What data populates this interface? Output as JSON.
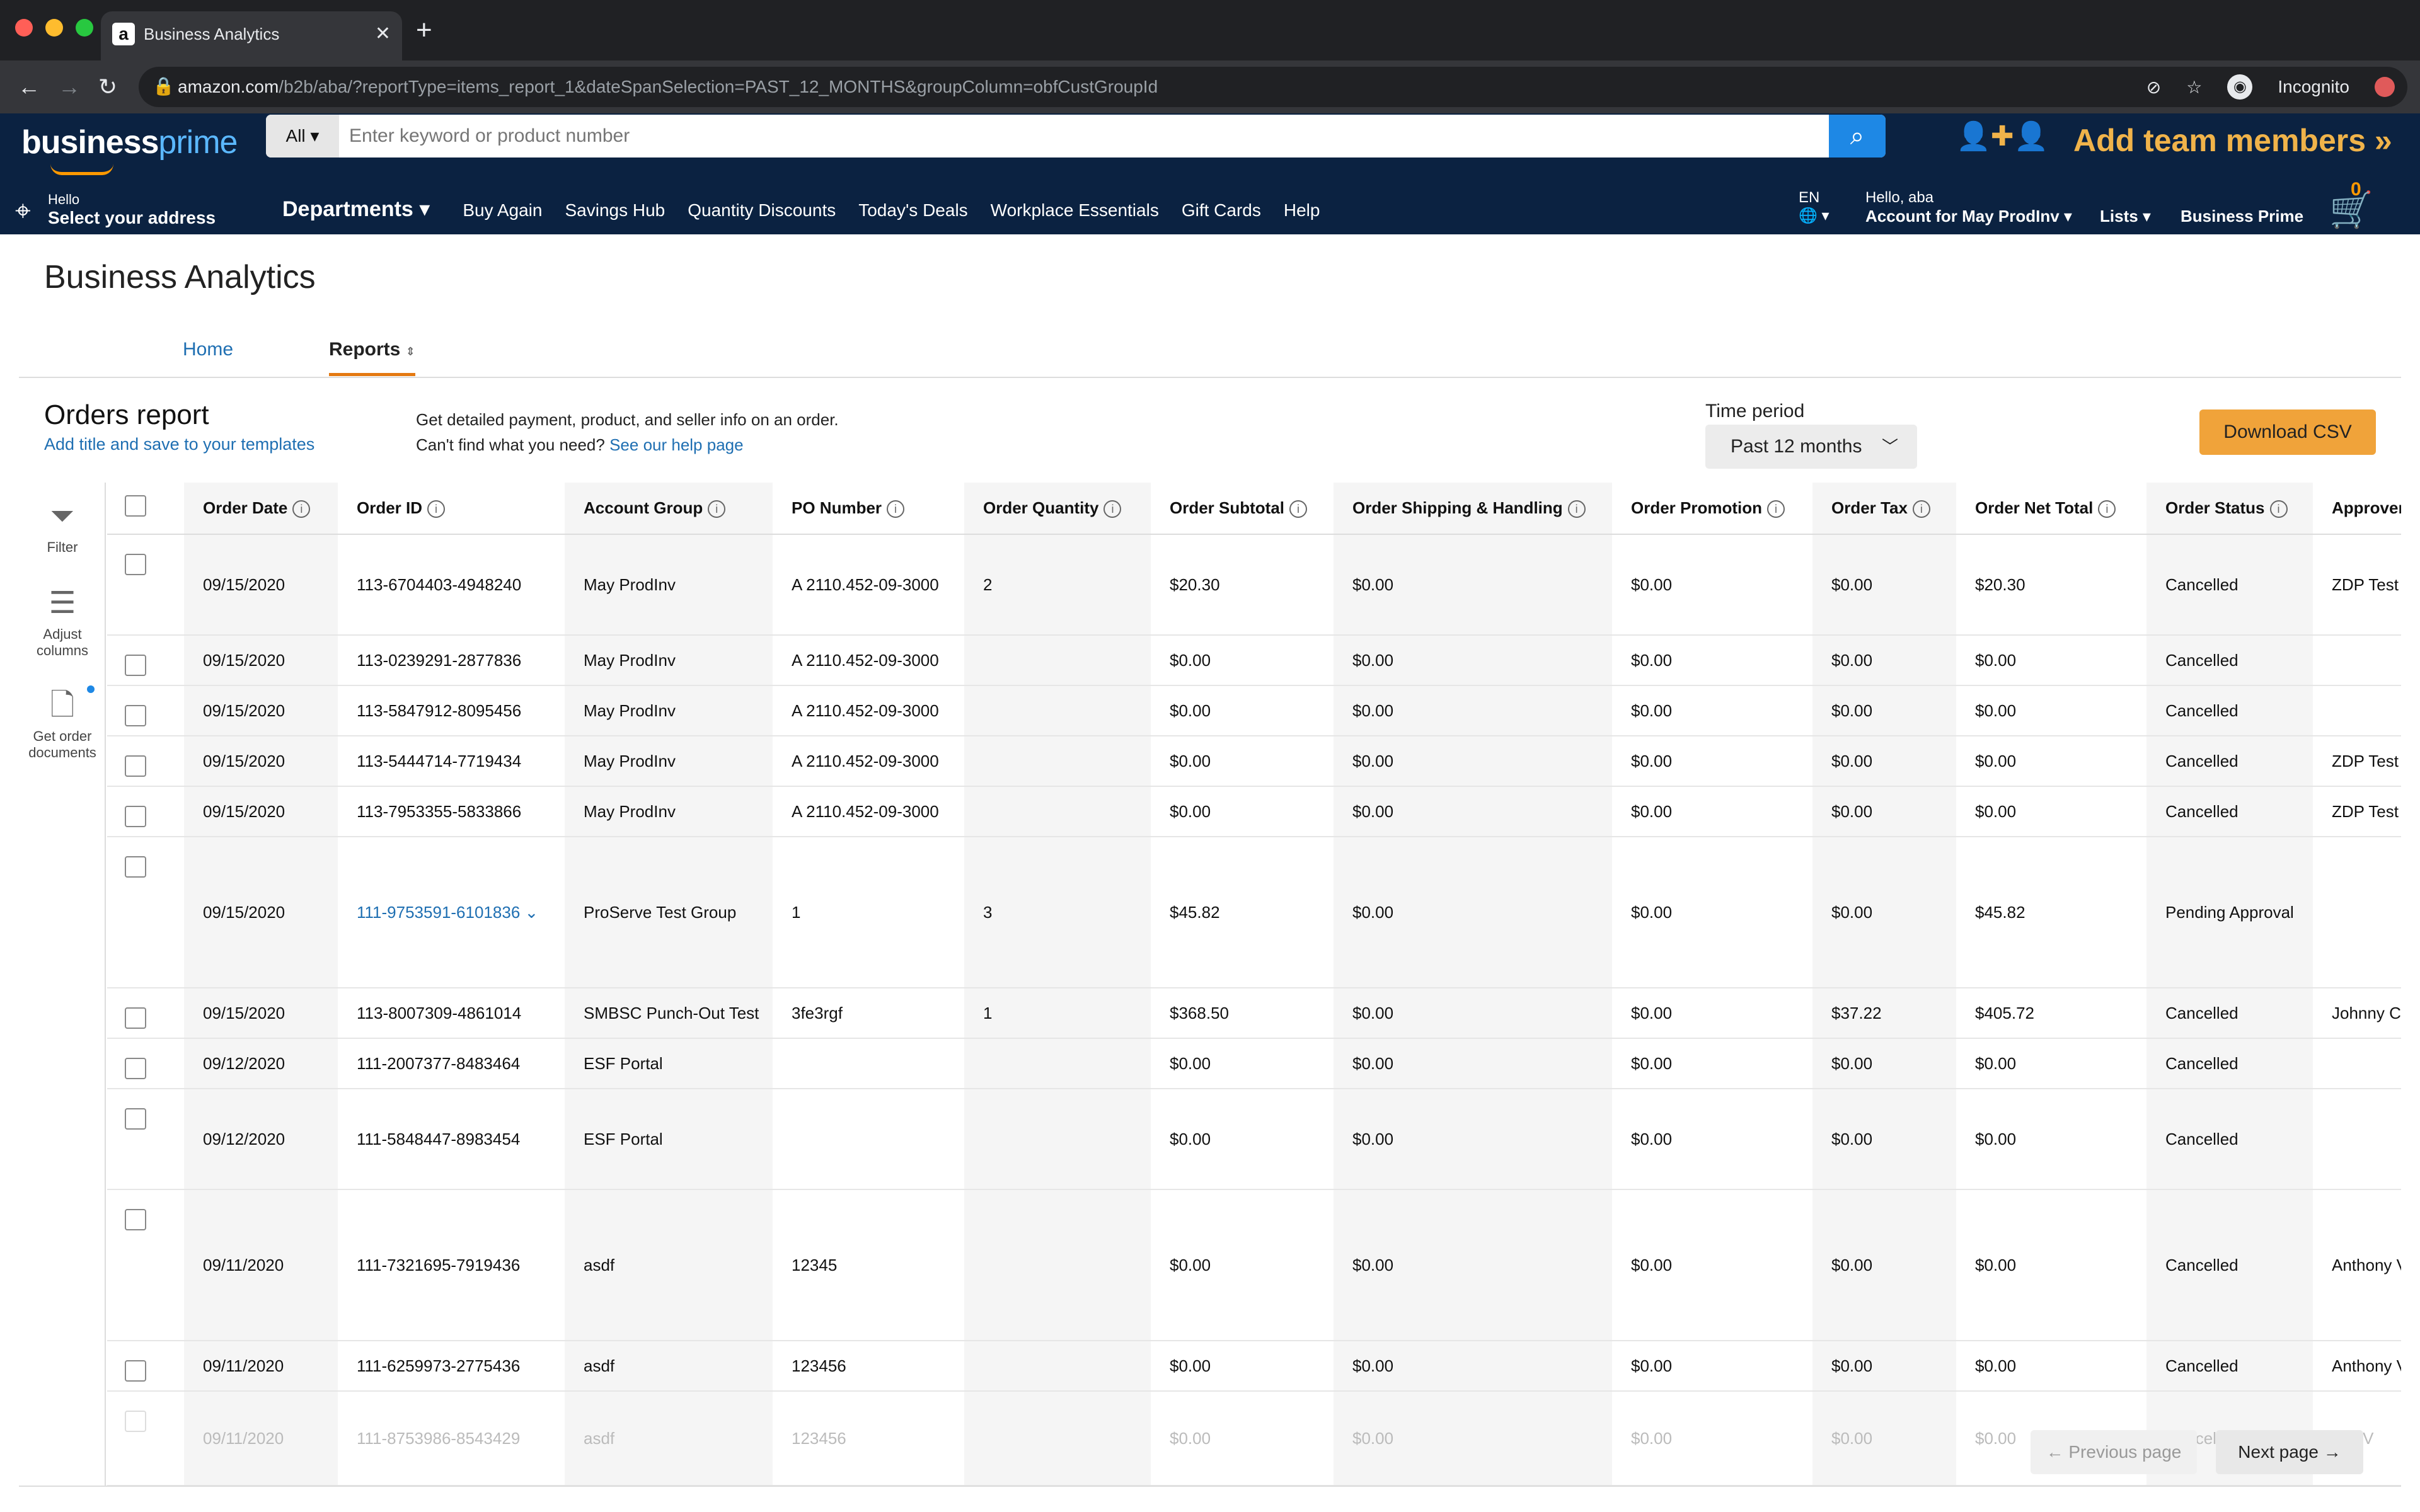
{
  "browser": {
    "tab_title": "Business Analytics",
    "url_host": "amazon.com",
    "url_path": "/b2b/aba/?reportType=items_report_1&dateSpanSelection=PAST_12_MONTHS&groupColumn=obfCustGroupId",
    "profile_label": "Incognito"
  },
  "header": {
    "logo_main": "business",
    "logo_accent": "prime",
    "search_category": "All",
    "search_placeholder": "Enter keyword or product number",
    "add_team_label": "Add team members »",
    "deliver_hello": "Hello",
    "deliver_address": "Select your address",
    "departments_label": "Departments",
    "nav_links": [
      "Buy Again",
      "Savings Hub",
      "Quantity Discounts",
      "Today's Deals",
      "Workplace Essentials",
      "Gift Cards",
      "Help"
    ],
    "language": "EN",
    "greeting": "Hello, aba",
    "account_label": "Account for May ProdInv",
    "lists_label": "Lists",
    "business_prime_label": "Business Prime",
    "cart_count": "0"
  },
  "page": {
    "title": "Business Analytics",
    "tabs": {
      "home": "Home",
      "reports": "Reports"
    }
  },
  "report": {
    "title": "Orders report",
    "subtitle_link": "Add title and save to your templates",
    "desc_line1": "Get detailed payment, product, and seller info on an order.",
    "desc_line2": "Can't find what you need?",
    "help_link": "See our help page",
    "time_period_label": "Time period",
    "time_period_value": "Past 12 months",
    "download_label": "Download CSV"
  },
  "rail": {
    "filter": "Filter",
    "adjust_line1": "Adjust",
    "adjust_line2": "columns",
    "docs_line1": "Get order",
    "docs_line2": "documents"
  },
  "table": {
    "columns": [
      "Order Date",
      "Order ID",
      "Account Group",
      "PO Number",
      "Order Quantity",
      "Order Subtotal",
      "Order Shipping & Handling",
      "Order Promotion",
      "Order Tax",
      "Order Net Total",
      "Order Status",
      "Approver"
    ],
    "rows": [
      [
        "09/15/2020",
        "113-6704403-4948240",
        "May ProdInv",
        "A 2110.452-09-3000",
        "2",
        "$20.30",
        "$0.00",
        "$0.00",
        "$0.00",
        "$20.30",
        "Cancelled",
        "ZDP Test ."
      ],
      [
        "09/15/2020",
        "113-0239291-2877836",
        "May ProdInv",
        "A 2110.452-09-3000",
        "",
        "$0.00",
        "$0.00",
        "$0.00",
        "$0.00",
        "$0.00",
        "Cancelled",
        ""
      ],
      [
        "09/15/2020",
        "113-5847912-8095456",
        "May ProdInv",
        "A 2110.452-09-3000",
        "",
        "$0.00",
        "$0.00",
        "$0.00",
        "$0.00",
        "$0.00",
        "Cancelled",
        ""
      ],
      [
        "09/15/2020",
        "113-5444714-7719434",
        "May ProdInv",
        "A 2110.452-09-3000",
        "",
        "$0.00",
        "$0.00",
        "$0.00",
        "$0.00",
        "$0.00",
        "Cancelled",
        "ZDP Test ."
      ],
      [
        "09/15/2020",
        "113-7953355-5833866",
        "May ProdInv",
        "A 2110.452-09-3000",
        "",
        "$0.00",
        "$0.00",
        "$0.00",
        "$0.00",
        "$0.00",
        "Cancelled",
        "ZDP Test ."
      ],
      [
        "09/15/2020",
        "111-9753591-6101836",
        "ProServe Test Group",
        "1",
        "3",
        "$45.82",
        "$0.00",
        "$0.00",
        "$0.00",
        "$45.82",
        "Pending Approval",
        ""
      ],
      [
        "09/15/2020",
        "113-8007309-4861014",
        "SMBSC Punch-Out Test",
        "3fe3rgf",
        "1",
        "$368.50",
        "$0.00",
        "$0.00",
        "$37.22",
        "$405.72",
        "Cancelled",
        "Johnny Ca"
      ],
      [
        "09/12/2020",
        "111-2007377-8483464",
        "ESF Portal",
        "",
        "",
        "$0.00",
        "$0.00",
        "$0.00",
        "$0.00",
        "$0.00",
        "Cancelled",
        ""
      ],
      [
        "09/12/2020",
        "111-5848447-8983454",
        "ESF Portal",
        "",
        "",
        "$0.00",
        "$0.00",
        "$0.00",
        "$0.00",
        "$0.00",
        "Cancelled",
        ""
      ],
      [
        "09/11/2020",
        "111-7321695-7919436",
        "asdf",
        "12345",
        "",
        "$0.00",
        "$0.00",
        "$0.00",
        "$0.00",
        "$0.00",
        "Cancelled",
        "Anthony V"
      ],
      [
        "09/11/2020",
        "111-6259973-2775436",
        "asdf",
        "123456",
        "",
        "$0.00",
        "$0.00",
        "$0.00",
        "$0.00",
        "$0.00",
        "Cancelled",
        "Anthony V"
      ],
      [
        "09/11/2020",
        "111-8753986-8543429",
        "asdf",
        "123456",
        "",
        "$0.00",
        "$0.00",
        "$0.00",
        "$0.00",
        "$0.00",
        "Cancelle",
        "ony V"
      ]
    ]
  },
  "pagination": {
    "previous": "← Previous page",
    "next": "Next page →"
  },
  "colors": {
    "header_bg": "#0b2241",
    "accent_orange": "#f0a33a",
    "link_blue": "#1f6fb2"
  }
}
